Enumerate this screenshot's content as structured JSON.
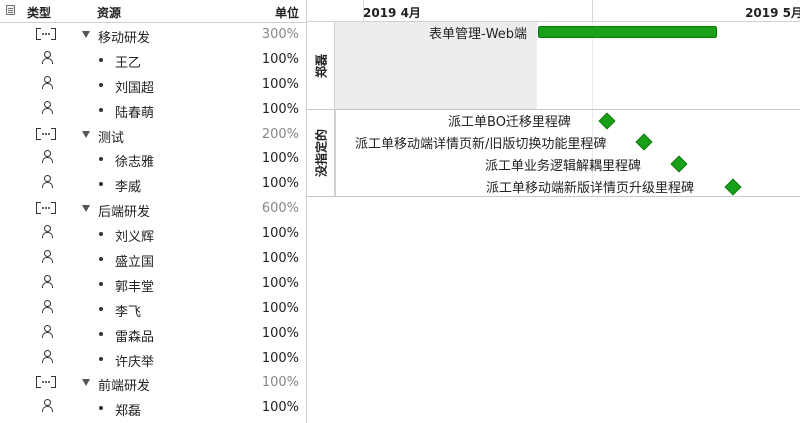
{
  "table": {
    "headers": {
      "type": "类型",
      "resource": "资源",
      "unit": "单位"
    },
    "rows": [
      {
        "kind": "group",
        "name": "移动研发",
        "unit": "300%"
      },
      {
        "kind": "person",
        "name": "王乙",
        "unit": "100%"
      },
      {
        "kind": "person",
        "name": "刘国超",
        "unit": "100%"
      },
      {
        "kind": "person",
        "name": "陆春萌",
        "unit": "100%"
      },
      {
        "kind": "group",
        "name": "测试",
        "unit": "200%"
      },
      {
        "kind": "person",
        "name": "徐志雅",
        "unit": "100%"
      },
      {
        "kind": "person",
        "name": "李威",
        "unit": "100%"
      },
      {
        "kind": "group",
        "name": "后端研发",
        "unit": "600%"
      },
      {
        "kind": "person",
        "name": "刘义辉",
        "unit": "100%"
      },
      {
        "kind": "person",
        "name": "盛立国",
        "unit": "100%"
      },
      {
        "kind": "person",
        "name": "郭丰堂",
        "unit": "100%"
      },
      {
        "kind": "person",
        "name": "李飞",
        "unit": "100%"
      },
      {
        "kind": "person",
        "name": "雷森品",
        "unit": "100%"
      },
      {
        "kind": "person",
        "name": "许庆举",
        "unit": "100%"
      },
      {
        "kind": "group",
        "name": "前端研发",
        "unit": "100%"
      },
      {
        "kind": "person",
        "name": "郑磊",
        "unit": "100%"
      }
    ]
  },
  "gantt": {
    "months": [
      "2019 4月",
      "2019 5月"
    ],
    "lanes": [
      {
        "label": "郑磊",
        "tasks": [
          {
            "name": "表单管理-Web端",
            "type": "bar"
          }
        ]
      },
      {
        "label": "没指定的",
        "tasks": [
          {
            "name": "派工单BO迁移里程碑",
            "type": "milestone"
          },
          {
            "name": "派工单移动端详情页新/旧版切换功能里程碑",
            "type": "milestone"
          },
          {
            "name": "派工单业务逻辑解耦里程碑",
            "type": "milestone"
          },
          {
            "name": "派工单移动端新版详情页升级里程碑",
            "type": "milestone"
          }
        ]
      }
    ],
    "colors": {
      "task": "#18a018",
      "task_border": "#0d7a0d",
      "shade": "#ededed"
    }
  }
}
